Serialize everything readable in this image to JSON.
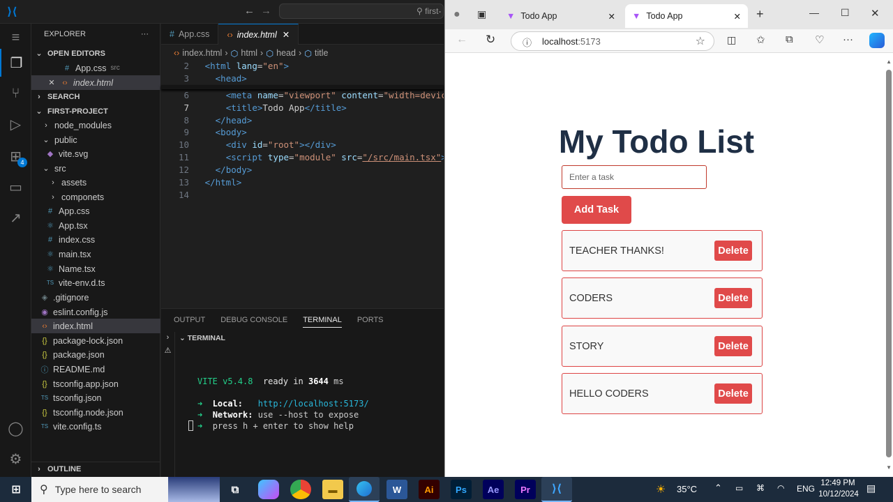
{
  "vscode": {
    "search_text": "first-",
    "explorer_title": "EXPLORER",
    "open_editors": "OPEN EDITORS",
    "open_files": [
      {
        "name": "App.css",
        "dir": "src"
      },
      {
        "name": "index.html",
        "dir": ""
      }
    ],
    "search_section": "SEARCH",
    "project": "FIRST-PROJECT",
    "tree": [
      "node_modules",
      "public",
      "vite.svg",
      "src",
      "assets",
      "componets",
      "App.css",
      "App.tsx",
      "index.css",
      "main.tsx",
      "Name.tsx",
      "vite-env.d.ts",
      ".gitignore",
      "eslint.config.js",
      "index.html",
      "package-lock.json",
      "package.json",
      "README.md",
      "tsconfig.app.json",
      "tsconfig.json",
      "tsconfig.node.json",
      "vite.config.ts"
    ],
    "outline": "OUTLINE",
    "tabs": [
      "App.css",
      "index.html"
    ],
    "breadcrumbs": [
      "index.html",
      "html",
      "head",
      "title"
    ],
    "line_numbers": [
      "2",
      "3",
      "6",
      "7",
      "8",
      "9",
      "10",
      "11",
      "12",
      "13",
      "14"
    ],
    "panel_tabs": [
      "OUTPUT",
      "DEBUG CONSOLE",
      "TERMINAL",
      "PORTS"
    ],
    "terminal_header": "TERMINAL",
    "terminal": {
      "vite": "VITE v5.4.8",
      "ready": "ready in",
      "ms": "3644",
      "ms_unit": "ms",
      "local_label": "Local:",
      "local_url": "http://localhost:5173/",
      "network_label": "Network:",
      "network_text": "use --host to expose",
      "help_text": "press h + enter to show help"
    },
    "badge_count": "4"
  },
  "browser": {
    "tabs": [
      "Todo App",
      "Todo App"
    ],
    "url_host": "localhost",
    "url_port": ":5173"
  },
  "todo": {
    "title": "My Todo List",
    "input_placeholder": "Enter a task",
    "add_label": "Add Task",
    "delete_label": "Delete",
    "items": [
      "TEACHER THANKS!",
      "CODERS",
      "STORY",
      "HELLO CODERS"
    ]
  },
  "taskbar": {
    "search_placeholder": "Type here to search",
    "weather": "35°C",
    "lang": "ENG",
    "time": "12:49 PM",
    "date": "10/12/2024"
  }
}
